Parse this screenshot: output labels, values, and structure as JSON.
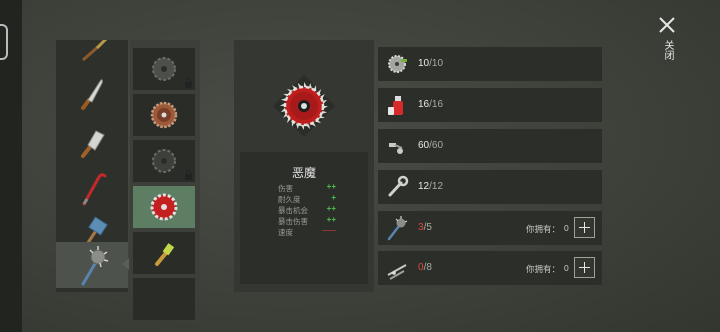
{
  "close": {
    "label": "关闭",
    "icon": "close-icon"
  },
  "weapons": [
    {
      "icon": "trident-icon",
      "selected": false
    },
    {
      "icon": "machete-icon",
      "selected": false
    },
    {
      "icon": "cleaver-icon",
      "selected": false
    },
    {
      "icon": "crowbar-icon",
      "selected": false
    },
    {
      "icon": "sledgehammer-icon",
      "selected": false
    },
    {
      "icon": "spiked-mace-icon",
      "selected": true
    }
  ],
  "blades": [
    {
      "icon": "sawblade-locked-icon",
      "locked": true,
      "selected": false
    },
    {
      "icon": "sawblade-bronze-icon",
      "locked": false,
      "selected": false
    },
    {
      "icon": "sawblade-dark-icon",
      "locked": true,
      "selected": false
    },
    {
      "icon": "sawblade-red-icon",
      "locked": false,
      "selected": true
    },
    {
      "icon": "spray-nozzle-icon",
      "locked": false,
      "selected": false
    }
  ],
  "selected_item": {
    "name": "恶魔",
    "icon": "red-sawblade-icon",
    "stats": [
      {
        "label": "伤害",
        "mark": "++",
        "color": "#4fc14f"
      },
      {
        "label": "耐久度",
        "mark": "+",
        "color": "#4fc14f"
      },
      {
        "label": "暴击机会",
        "mark": "++",
        "color": "#4fc14f"
      },
      {
        "label": "暴击伤害",
        "mark": "++",
        "color": "#4fc14f"
      },
      {
        "label": "速度",
        "mark": "——",
        "color": "#e0463c"
      }
    ]
  },
  "resources": [
    {
      "icon": "sawblade-part-icon",
      "current": "10",
      "max": "/10",
      "low": false,
      "own": null
    },
    {
      "icon": "fuel-canister-icon",
      "current": "16",
      "max": "/16",
      "low": false,
      "own": null
    },
    {
      "icon": "bolts-icon",
      "current": "60",
      "max": "/60",
      "low": false,
      "own": null
    },
    {
      "icon": "wrench-icon",
      "current": "12",
      "max": "/12",
      "low": false,
      "own": null
    },
    {
      "icon": "spiked-mace-icon",
      "current": "3",
      "max": "/5",
      "low": true,
      "own": {
        "label": "你拥有：",
        "value": "0"
      }
    },
    {
      "icon": "pipe-parts-icon",
      "current": "0",
      "max": "/8",
      "low": true,
      "own": {
        "label": "你拥有：",
        "value": "0"
      }
    }
  ],
  "colors": {
    "accent_green": "#4fc14f",
    "warning_red": "#e0463c",
    "selected_blade_bg": "#5e7e63"
  }
}
